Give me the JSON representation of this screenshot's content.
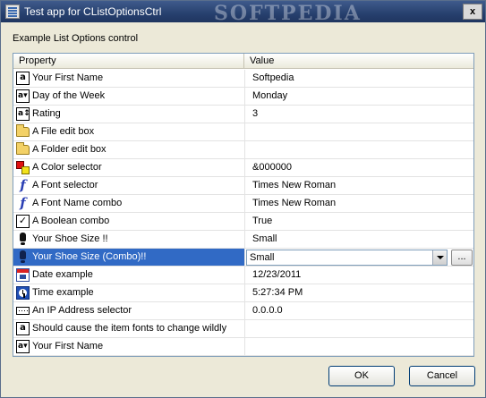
{
  "window": {
    "title": "Test app for CListOptionsCtrl",
    "watermark": "SOFTPEDIA",
    "close_label": "x"
  },
  "group_label": "Example List Options control",
  "list": {
    "columns": [
      "Property",
      "Value"
    ],
    "rows": [
      {
        "icon": "text-icon",
        "label": "Your First Name",
        "value": "Softpedia"
      },
      {
        "icon": "combo-icon",
        "label": "Day of the Week",
        "value": "Monday"
      },
      {
        "icon": "spin-icon",
        "label": "Rating",
        "value": "3"
      },
      {
        "icon": "folder-icon",
        "label": "A File edit box",
        "value": ""
      },
      {
        "icon": "folder-icon",
        "label": "A Folder edit box",
        "value": ""
      },
      {
        "icon": "color-icon",
        "label": "A Color selector",
        "value": "&000000"
      },
      {
        "icon": "font-icon",
        "label": "A Font selector",
        "value": "Times New Roman"
      },
      {
        "icon": "font-icon",
        "label": "A Font Name combo",
        "value": "Times New Roman"
      },
      {
        "icon": "checkbox-icon",
        "label": "A Boolean combo",
        "value": "True"
      },
      {
        "icon": "shoe-icon",
        "label": "Your Shoe Size !!",
        "value": "Small"
      },
      {
        "icon": "shoe-icon",
        "label": "Your Shoe Size (Combo)!!",
        "value": "Small",
        "selected": true
      },
      {
        "icon": "calendar-icon",
        "label": "Date example",
        "value": "12/23/2011"
      },
      {
        "icon": "clock-icon",
        "label": "Time example",
        "value": "5:27:34 PM"
      },
      {
        "icon": "ip-icon",
        "label": "An IP Address selector",
        "value": "0.0.0.0"
      },
      {
        "icon": "text-icon",
        "label": "Should cause the item fonts to change wildly",
        "value": ""
      },
      {
        "icon": "combo-icon",
        "label": "Your First Name",
        "value": ""
      }
    ],
    "editor": {
      "value": "Small",
      "ellipsis_label": "..."
    }
  },
  "buttons": {
    "ok": "OK",
    "cancel": "Cancel"
  },
  "colors": {
    "selection": "#316ac5",
    "titlebar": "#27406e",
    "dialog": "#ece9d8"
  }
}
